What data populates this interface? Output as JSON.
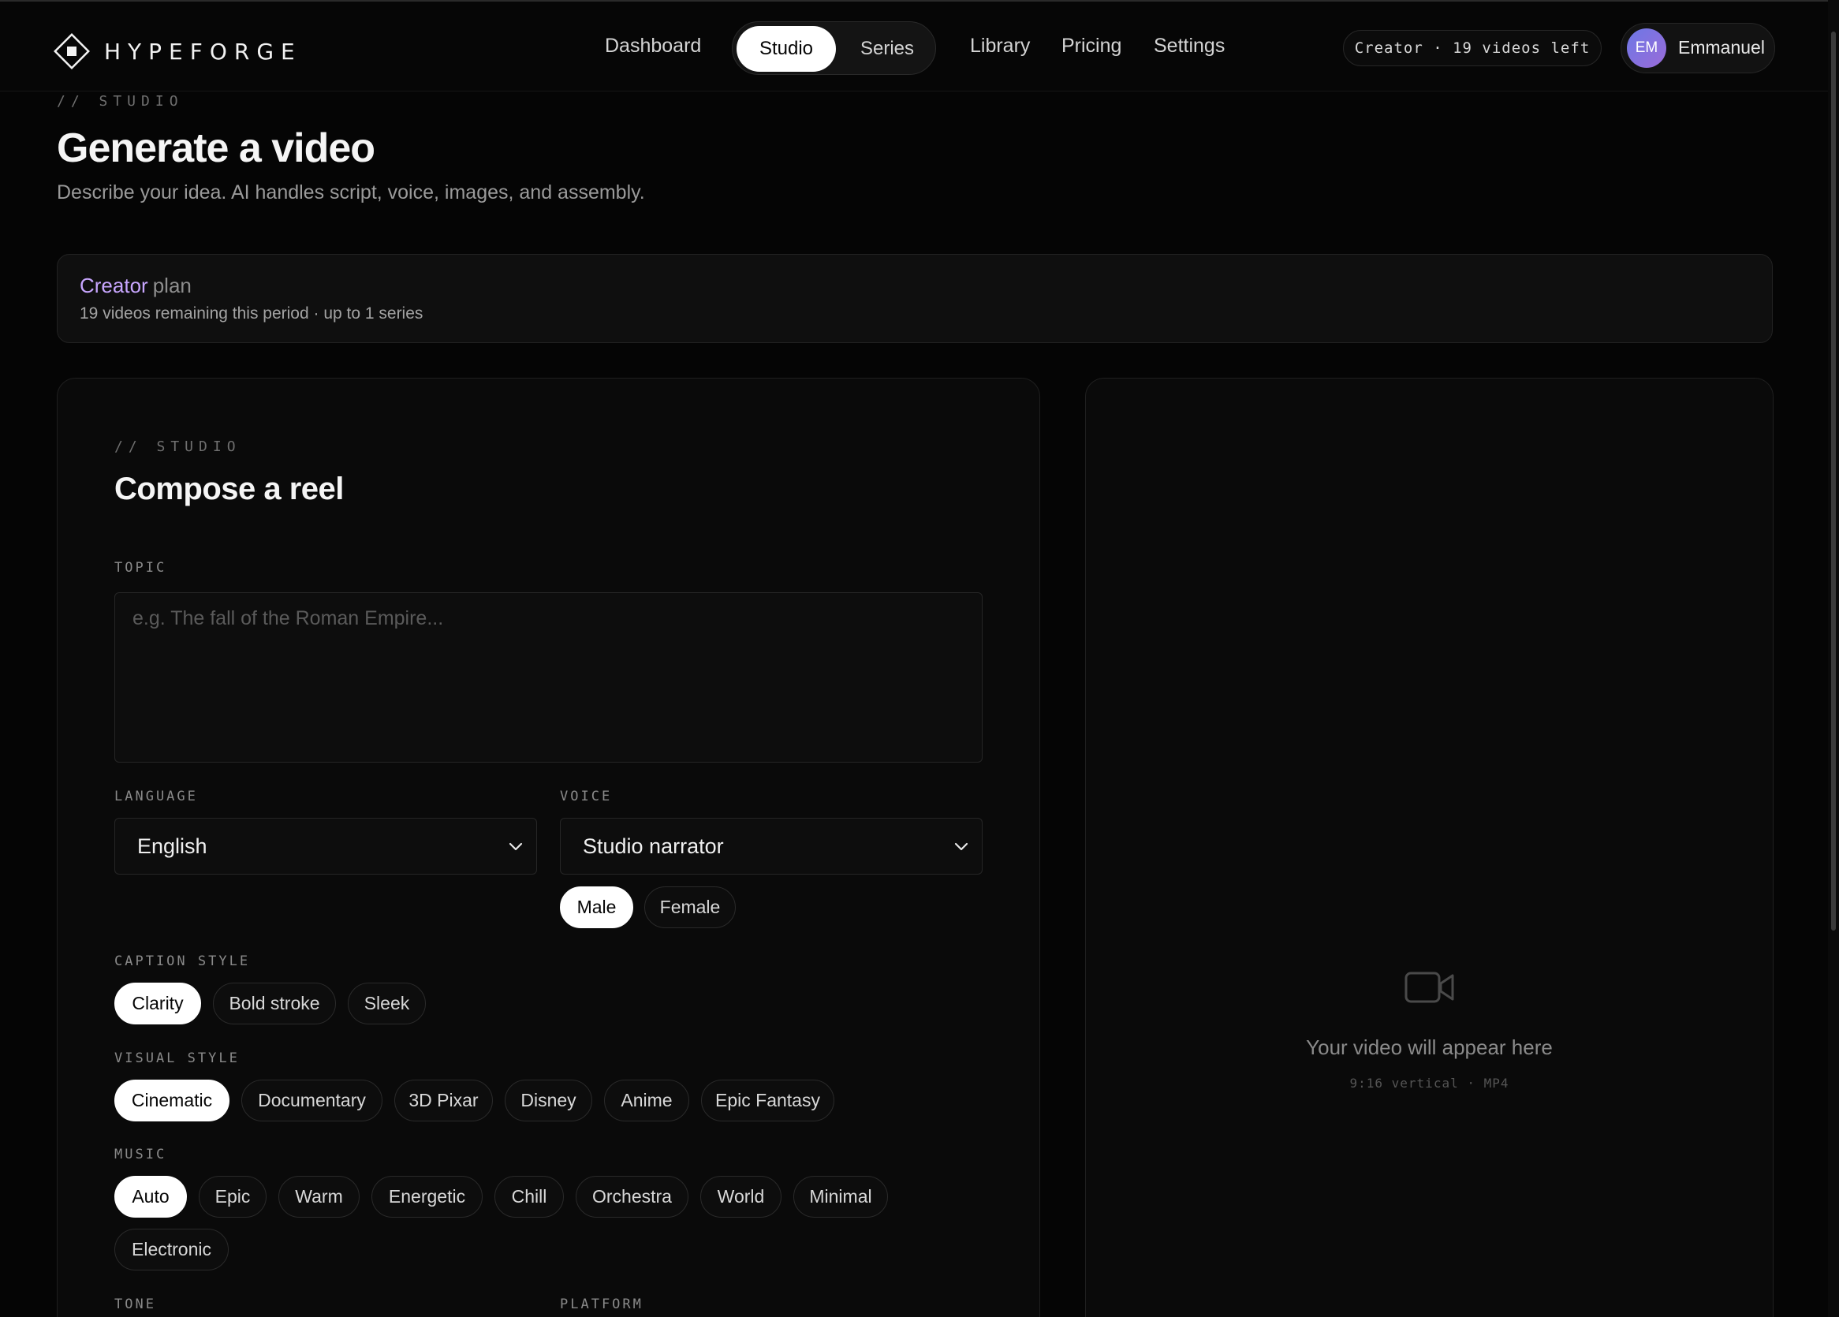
{
  "nav": {
    "brand": "HYPEFORGE",
    "links": {
      "dashboard": "Dashboard",
      "studio": "Studio",
      "series": "Series",
      "library": "Library",
      "pricing": "Pricing",
      "settings": "Settings"
    },
    "active_link": "Studio",
    "quota_badge": "Creator · 19 videos left",
    "user": {
      "initials": "EM",
      "name": "Emmanuel"
    }
  },
  "header": {
    "eyebrow": "// STUDIO",
    "title": "Generate a video",
    "subtitle": "Describe your idea. AI handles script, voice, images, and assembly."
  },
  "plan": {
    "name": "Creator",
    "suffix": "plan",
    "detail": "19 videos remaining this period · up to 1 series"
  },
  "compose": {
    "eyebrow": "// STUDIO",
    "title": "Compose a reel",
    "topic": {
      "label": "TOPIC",
      "value": "",
      "placeholder": "e.g. The fall of the Roman Empire..."
    },
    "language": {
      "label": "LANGUAGE",
      "value": "English"
    },
    "voice": {
      "label": "VOICE",
      "value": "Studio narrator",
      "genders": [
        "Male",
        "Female"
      ],
      "selected_gender": "Male"
    },
    "caption_style": {
      "label": "CAPTION STYLE",
      "options": [
        "Clarity",
        "Bold stroke",
        "Sleek"
      ],
      "selected": "Clarity"
    },
    "visual_style": {
      "label": "VISUAL STYLE",
      "options": [
        "Cinematic",
        "Documentary",
        "3D Pixar",
        "Disney",
        "Anime",
        "Epic Fantasy"
      ],
      "selected": "Cinematic"
    },
    "music": {
      "label": "MUSIC",
      "options": [
        "Auto",
        "Epic",
        "Warm",
        "Energetic",
        "Chill",
        "Orchestra",
        "World",
        "Minimal",
        "Electronic"
      ],
      "selected": "Auto"
    },
    "tone": {
      "label": "TONE"
    },
    "platform": {
      "label": "PLATFORM"
    }
  },
  "preview": {
    "empty_title": "Your video will appear here",
    "empty_meta": "9:16 vertical · MP4"
  },
  "colors": {
    "accent": "#c8a6ff",
    "background": "#050505",
    "panel": "#0a0a0a",
    "chip_active": "#ffffff"
  },
  "icons": {
    "logo": "diamond-logo-icon",
    "dropdown": "chevron-down-icon",
    "preview": "video-camera-icon"
  }
}
